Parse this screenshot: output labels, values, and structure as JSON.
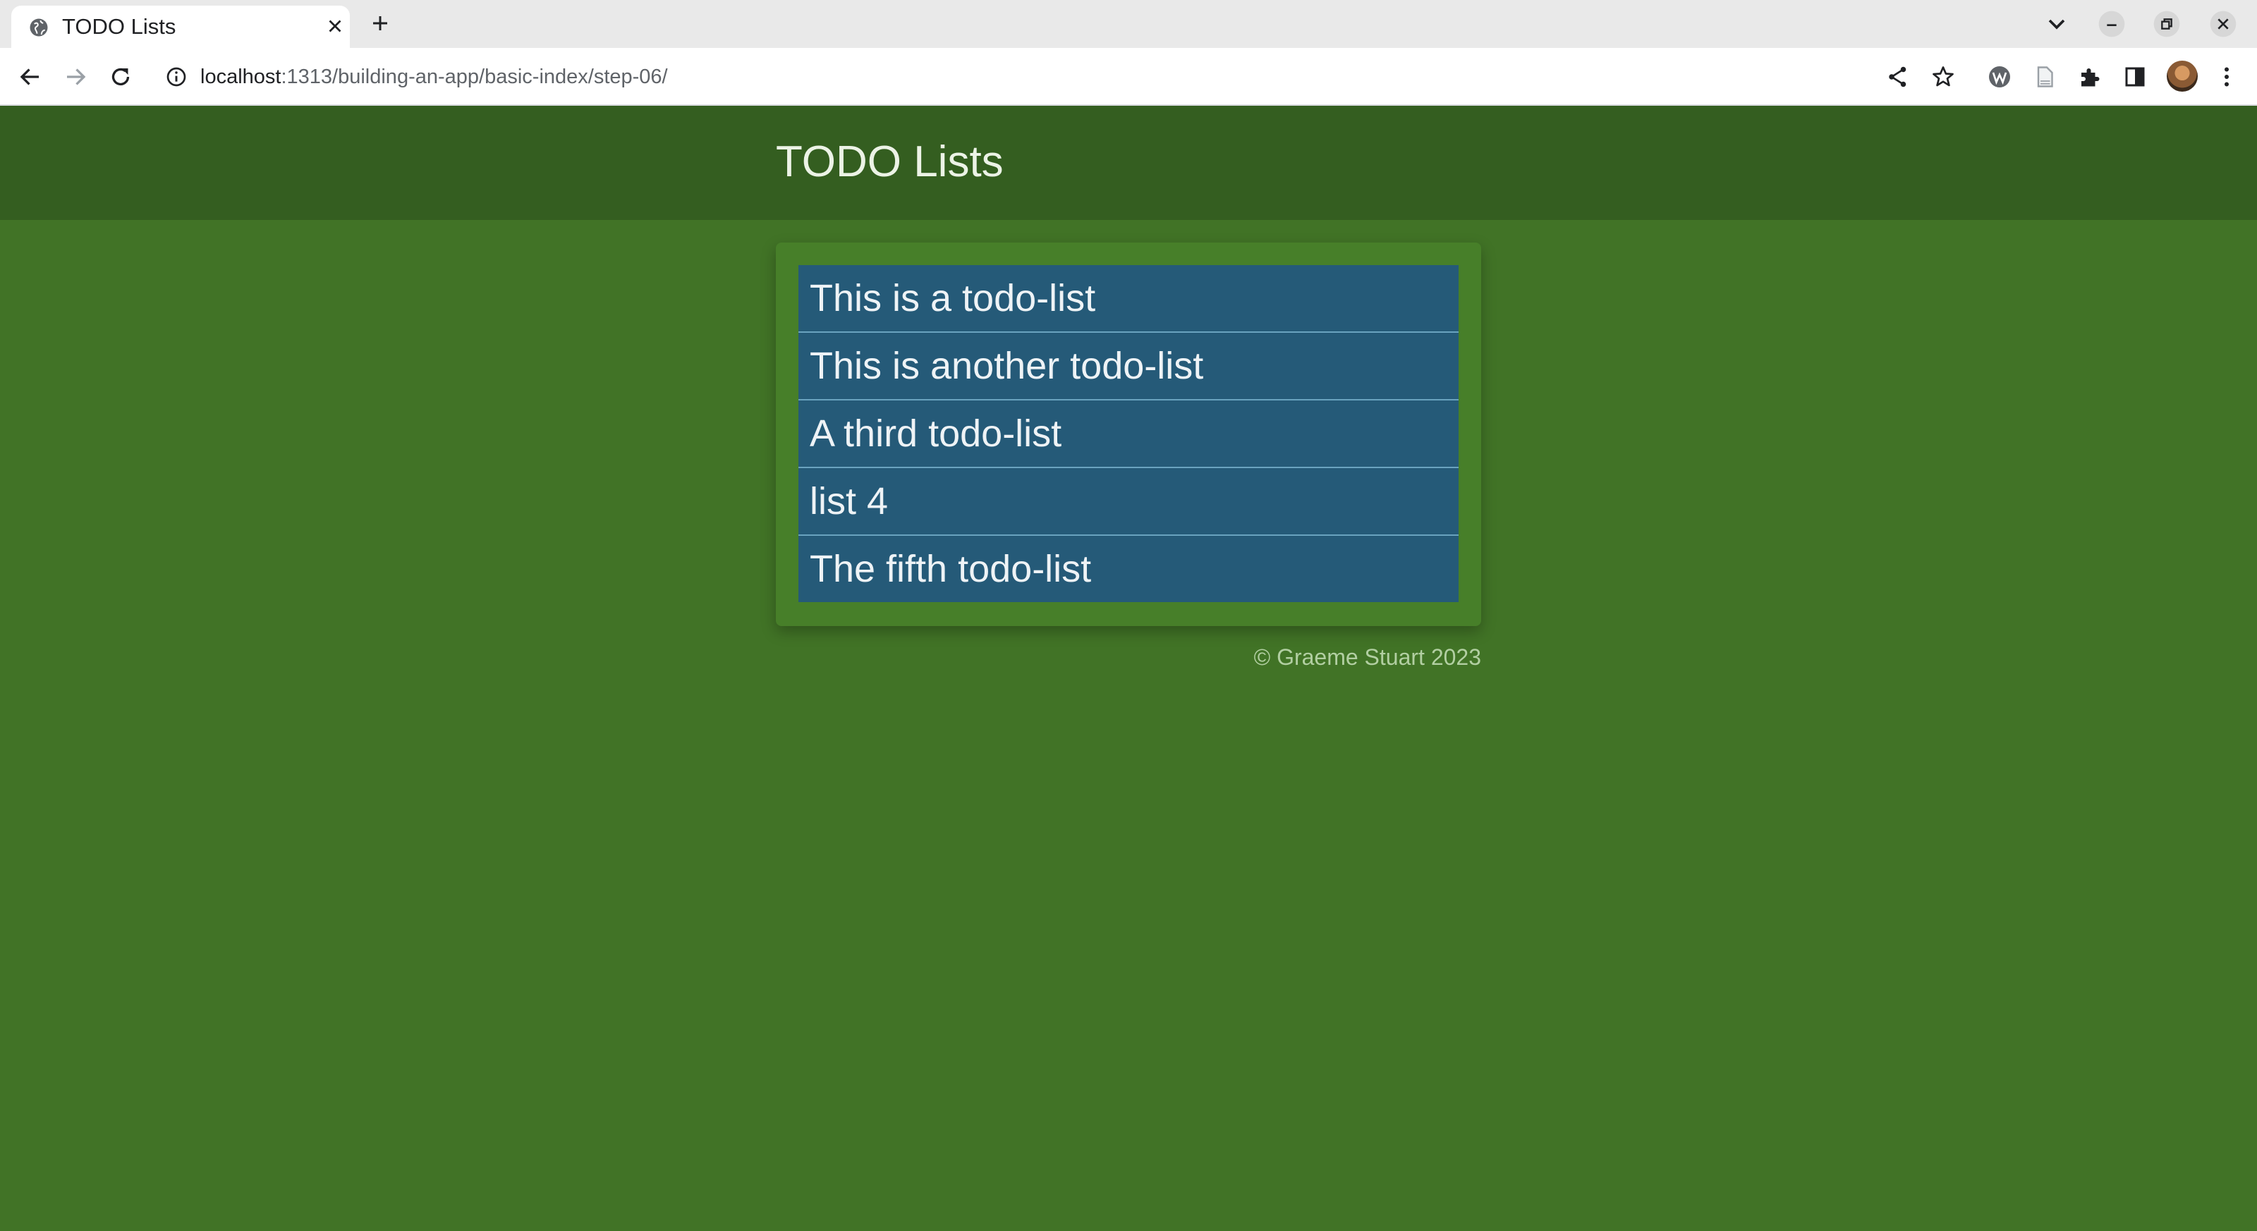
{
  "browser": {
    "tab_title": "TODO Lists",
    "url_host": "localhost",
    "url_path": ":1313/building-an-app/basic-index/step-06/",
    "icons": {
      "favicon": "globe-icon",
      "tab_close": "close-icon",
      "new_tab": "plus-icon",
      "tab_list": "chevron-down-icon",
      "minimize": "minimize-icon",
      "restore": "restore-icon",
      "close_window": "close-icon",
      "back": "arrow-left-icon",
      "forward": "arrow-right-icon",
      "reload": "reload-icon",
      "site_info": "info-icon",
      "share": "share-icon",
      "bookmark": "star-icon",
      "ext_w": "w-extension-icon",
      "ext_doc": "document-icon",
      "extensions": "puzzle-icon",
      "side_panel": "side-panel-icon",
      "menu": "kebab-menu-icon"
    }
  },
  "page": {
    "title": "TODO Lists",
    "lists": [
      {
        "label": "This is a todo-list"
      },
      {
        "label": "This is another todo-list"
      },
      {
        "label": "A third todo-list"
      },
      {
        "label": "list 4"
      },
      {
        "label": "The fifth todo-list"
      }
    ],
    "footer": "© Graeme Stuart 2023"
  },
  "colors": {
    "page_background": "#417326",
    "header_background": "#345e20",
    "panel_background": "#477f29",
    "list_item_background": "#255a78",
    "list_item_divider": "#6aa3bf"
  }
}
